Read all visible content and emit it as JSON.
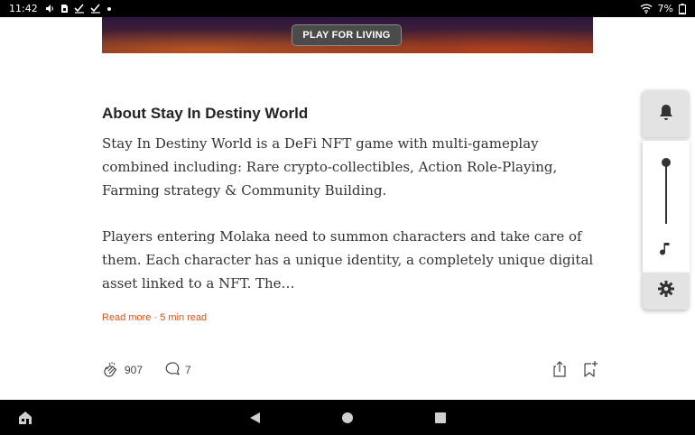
{
  "status_bar": {
    "time": "11:42",
    "battery": "7%",
    "icons": [
      "media-volume-icon",
      "sim-card-icon",
      "check-icon",
      "check-icon",
      "dot-icon",
      "wifi-icon",
      "battery-icon"
    ]
  },
  "banner": {
    "button_label": "PLAY FOR LIVING"
  },
  "article": {
    "title": "About Stay In Destiny World",
    "paragraph1": "Stay In Destiny World is a DeFi NFT game with multi-gameplay combined including: Rare crypto-collectibles, Action Role-Playing, Farming strategy & Community Building.",
    "paragraph2": "Players entering Molaka need to summon characters and take care of them. Each character has a unique identity, a completely unique digital asset linked to a NFT. The…",
    "read_more": "Read more",
    "separator": " · ",
    "read_time": "5 min read"
  },
  "reactions": {
    "claps": "907",
    "comments": "7"
  },
  "colors": {
    "accent": "#d9531e",
    "text": "#242424",
    "panel_bg": "#e3e3e3"
  }
}
